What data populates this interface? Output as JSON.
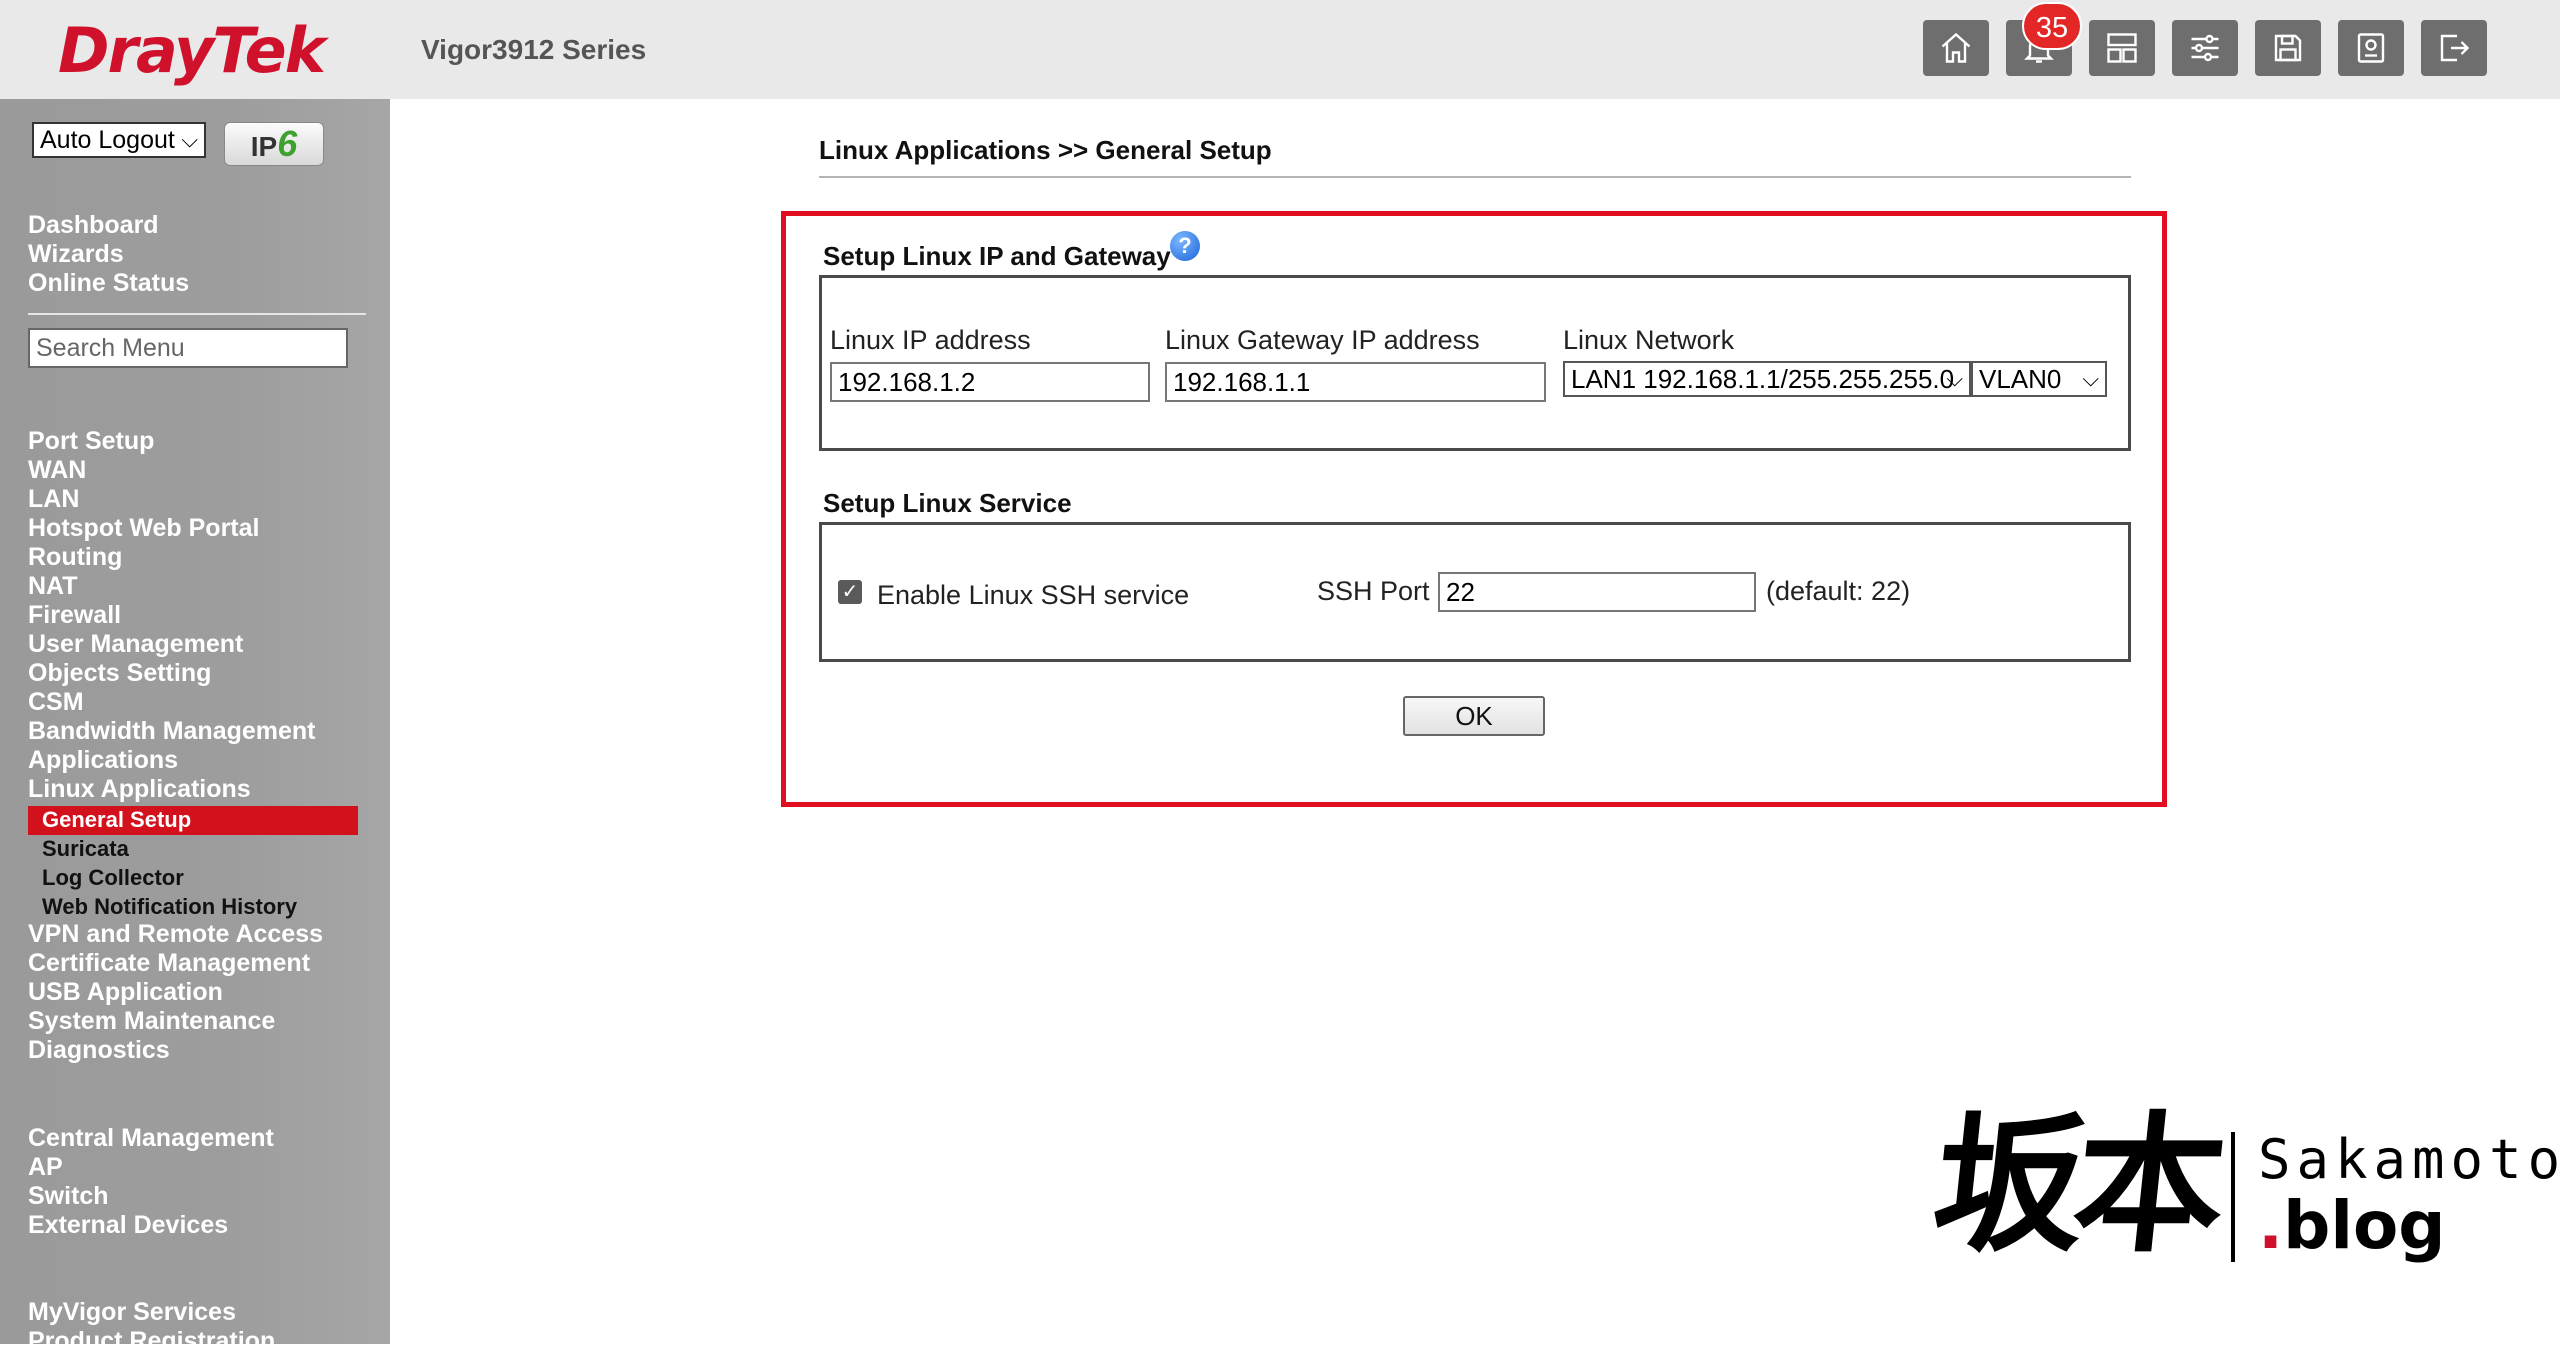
{
  "header": {
    "brand": "DrayTek",
    "model": "Vigor3912 Series",
    "notification_count": "35",
    "buttons": [
      "home-icon",
      "bell-icon",
      "dashboard-layout-icon",
      "sliders-icon",
      "save-icon",
      "backup-icon",
      "logout-icon"
    ]
  },
  "sidebar": {
    "auto_logout": "Auto Logout",
    "ipv6_label": "IP",
    "ipv6_suffix": "6",
    "top_items": [
      "Dashboard",
      "Wizards",
      "Online Status"
    ],
    "search_placeholder": "Search Menu",
    "items": [
      "Port Setup",
      "WAN",
      "LAN",
      "Hotspot Web Portal",
      "Routing",
      "NAT",
      "Firewall",
      "User Management",
      "Objects Setting",
      "CSM",
      "Bandwidth Management",
      "Applications",
      "Linux Applications"
    ],
    "sub_items": [
      "General Setup",
      "Suricata",
      "Log Collector",
      "Web Notification History"
    ],
    "items_after": [
      "VPN and Remote Access",
      "Certificate Management",
      "USB Application",
      "System Maintenance",
      "Diagnostics"
    ],
    "central_items": [
      "Central Management",
      "AP",
      "Switch",
      "External Devices"
    ],
    "bottom_items": [
      "MyVigor Services",
      "Product Registration"
    ],
    "active_color": "#d3111d"
  },
  "main": {
    "breadcrumb": "Linux Applications >> General Setup",
    "section_ip": {
      "title": "Setup Linux IP and Gateway",
      "ip_label": "Linux IP address",
      "ip_value": "192.168.1.2",
      "gateway_label": "Linux Gateway IP address",
      "gateway_value": "192.168.1.1",
      "network_label": "Linux Network",
      "network_value": "LAN1 192.168.1.1/255.255.255.0",
      "vlan_value": "VLAN0"
    },
    "section_service": {
      "title": "Setup Linux Service",
      "ssh_label": "Enable Linux SSH service",
      "ssh_enabled": true,
      "port_label": "SSH Port",
      "port_value": "22",
      "port_hint": "(default: 22)"
    },
    "ok_label": "OK",
    "highlight_color": "#e00e1f"
  },
  "watermark": {
    "kanji": "坂本",
    "name": "Sakamoto",
    "dot": ".",
    "domain": "blog"
  }
}
